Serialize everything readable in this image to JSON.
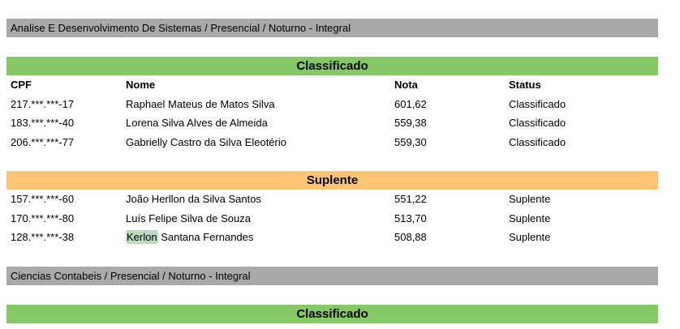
{
  "courses": [
    {
      "title": "Analise E Desenvolvimento De Sistemas / Presencial / Noturno - Integral",
      "classificado_label": "Classificado",
      "headers": {
        "cpf": "CPF",
        "nome": "Nome",
        "nota": "Nota",
        "status": "Status"
      },
      "classificados": [
        {
          "cpf": "217.***.***-17",
          "nome": "Raphael Mateus de Matos Silva",
          "nota": "601,62",
          "status": "Classificado"
        },
        {
          "cpf": "183.***.***-40",
          "nome": "Lorena Silva Alves de Almeida",
          "nota": "559,38",
          "status": "Classificado"
        },
        {
          "cpf": "206.***.***-77",
          "nome": "Gabrielly Castro da Silva Eleotério",
          "nota": "559,30",
          "status": "Classificado"
        }
      ],
      "suplente_label": "Suplente",
      "suplentes": [
        {
          "cpf": "157.***.***-60",
          "nome": "João Herllon da Silva Santos",
          "nota": "551,22",
          "status": "Suplente"
        },
        {
          "cpf": "170.***.***-80",
          "nome": "Luís Felipe Silva de Souza",
          "nota": "513,70",
          "status": "Suplente"
        },
        {
          "cpf": "128.***.***-38",
          "nome_highlight": "Kerlon",
          "nome_rest": " Santana Fernandes",
          "nota": "508,88",
          "status": "Suplente"
        }
      ]
    },
    {
      "title": "Ciencias Contabeis / Presencial / Noturno - Integral",
      "classificado_label": "Classificado"
    }
  ]
}
